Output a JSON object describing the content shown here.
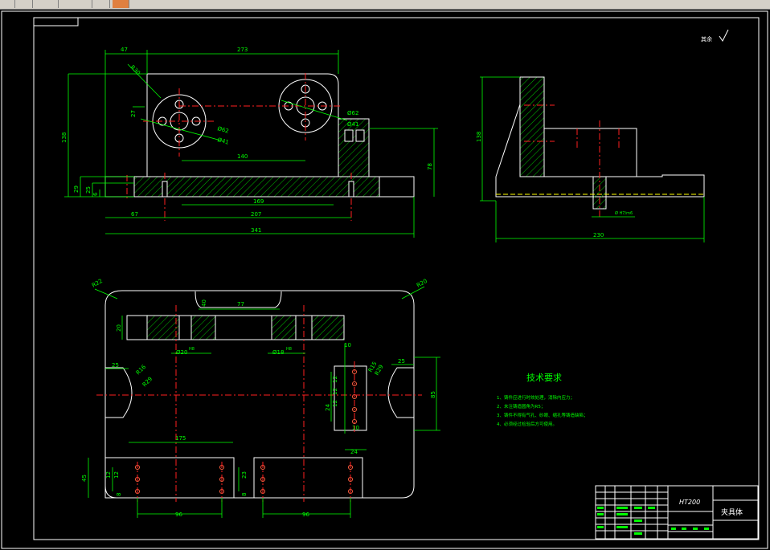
{
  "colors": {
    "background": "#000000",
    "frame": "#ffffff",
    "dimension": "#00ff00",
    "centerline": "#ff2020",
    "hatch": "#00c000",
    "text_dim": "#00ff00",
    "title_text": "#ffffff",
    "tech_title": "#00ff00",
    "dash_yellow": "#ffff00"
  },
  "toolbar": {
    "icons": [
      "pointer-icon",
      "layer-icon",
      "layer-state-icon",
      "arrow-icon",
      "cursor-icon",
      "paint-icon"
    ]
  },
  "roughness": {
    "label": "其余"
  },
  "front_view": {
    "dims": {
      "d47": "47",
      "d273": "273",
      "r30": "R30",
      "d27": "27",
      "d62": "Ø62",
      "d41": "Ø41",
      "d140": "140",
      "d62b": "Ø62",
      "d41b": "Ø41",
      "d138": "138",
      "d29": "29",
      "d25": "25",
      "d6": "6",
      "d78": "78",
      "d169": "169",
      "d67": "67",
      "d207": "207",
      "d341": "341"
    }
  },
  "side_view": {
    "dims": {
      "d138": "138",
      "d230": "230",
      "fit": "Ø H7/m6"
    }
  },
  "top_view": {
    "dims": {
      "r22": "R22",
      "r20": "R20",
      "d40": "40",
      "d77": "77",
      "d20": "20",
      "d20h8": "Ø20",
      "h8a": "H8",
      "d18h8": "Ø18",
      "h8b": "H8",
      "d25a": "25",
      "r16": "R16",
      "r29": "R29",
      "d10": "10",
      "r15": "R15",
      "r29b": "R29",
      "d25b": "25",
      "d85": "85",
      "d12a": "12",
      "d12b": "12",
      "d12c": "12",
      "d24": "24",
      "d10b": "10",
      "d24b": "24",
      "d175": "175",
      "d45": "45",
      "d12d": "12",
      "d12e": "12",
      "d8": "8",
      "d23": "23",
      "d8b": "8",
      "d96a": "96",
      "d96b": "96"
    }
  },
  "tech": {
    "title": "技术要求",
    "items": [
      "1、铸件应进行时效处理，消除内应力；",
      "2、未注铸造圆角为R5；",
      "3、铸件不得有气孔、砂眼、缩孔等铸造缺陷；",
      "4、必须经过检验后方可使用。"
    ]
  },
  "title_block": {
    "material": "HT200",
    "name": "夹具体"
  }
}
